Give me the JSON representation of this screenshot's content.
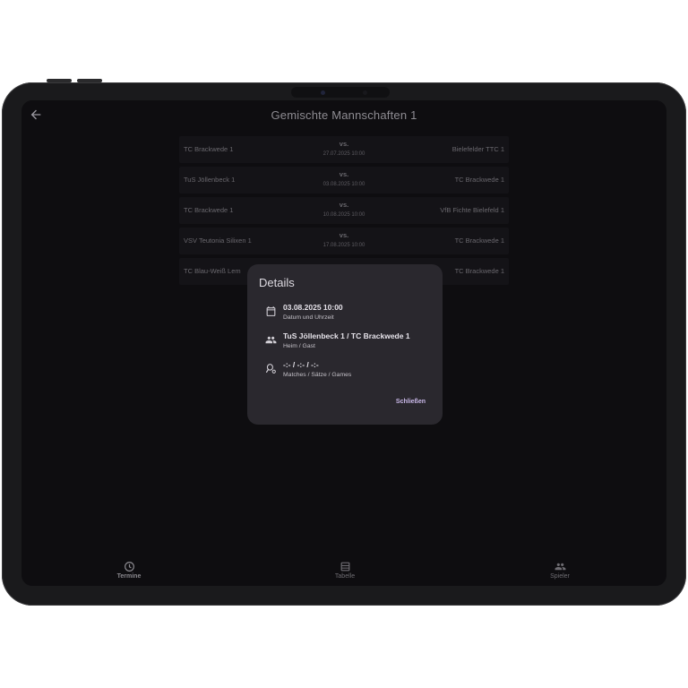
{
  "header": {
    "title": "Gemischte Mannschaften 1"
  },
  "matches": [
    {
      "home": "TC Brackwede 1",
      "vs": "vs.",
      "date": "27.07.2025 10:00",
      "guest": "Bielefelder TTC 1"
    },
    {
      "home": "TuS Jöllenbeck 1",
      "vs": "vs.",
      "date": "03.08.2025 10:00",
      "guest": "TC Brackwede 1"
    },
    {
      "home": "TC Brackwede 1",
      "vs": "vs.",
      "date": "10.08.2025 10:00",
      "guest": "VfB Fichte Bielefeld 1"
    },
    {
      "home": "VSV Teutonia Silixen 1",
      "vs": "vs.",
      "date": "17.08.2025 10:00",
      "guest": "TC Brackwede 1"
    },
    {
      "home": "TC Blau-Weiß Lem",
      "vs": "",
      "date": "",
      "guest": "TC Brackwede 1"
    }
  ],
  "dialog": {
    "title": "Details",
    "items": [
      {
        "icon": "calendar-icon",
        "main": "03.08.2025 10:00",
        "sub": "Datum und Uhrzeit"
      },
      {
        "icon": "people-icon",
        "main": "TuS Jöllenbeck 1 / TC Brackwede 1",
        "sub": "Heim / Gast"
      },
      {
        "icon": "tennis-racket-icon",
        "main": "-:- / -:- / -:-",
        "sub": "Matches / Sätze / Games"
      }
    ],
    "close_label": "Schließen"
  },
  "bottom_nav": [
    {
      "icon": "clock-icon",
      "label": "Termine",
      "active": true
    },
    {
      "icon": "table-icon",
      "label": "Tabelle",
      "active": false
    },
    {
      "icon": "people-icon",
      "label": "Spieler",
      "active": false
    }
  ]
}
